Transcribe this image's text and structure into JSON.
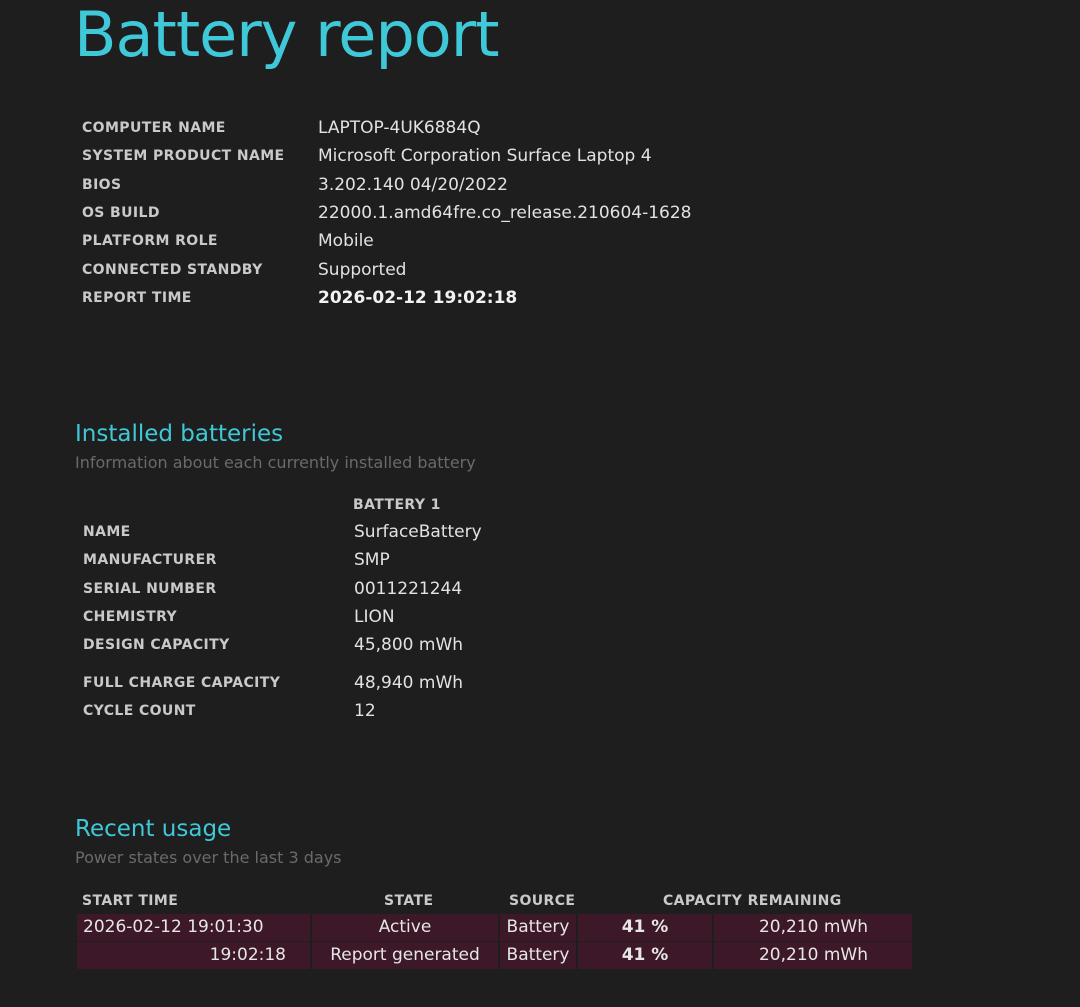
{
  "report": {
    "title": "Battery report"
  },
  "system": {
    "rows": [
      {
        "label": "COMPUTER NAME",
        "value": "LAPTOP-4UK6884Q"
      },
      {
        "label": "SYSTEM PRODUCT NAME",
        "value": "Microsoft Corporation Surface Laptop 4"
      },
      {
        "label": "BIOS",
        "value": "3.202.140 04/20/2022"
      },
      {
        "label": "OS BUILD",
        "value": "22000.1.amd64fre.co_release.210604-1628"
      },
      {
        "label": "PLATFORM ROLE",
        "value": "Mobile"
      },
      {
        "label": "CONNECTED STANDBY",
        "value": "Supported"
      },
      {
        "label": "REPORT TIME",
        "value": "2026-02-12  19:02:18"
      }
    ]
  },
  "installed_batteries": {
    "title": "Installed batteries",
    "subtitle": "Information about each currently installed battery",
    "column_header": "BATTERY 1",
    "rows": [
      {
        "label": "NAME",
        "value": "SurfaceBattery"
      },
      {
        "label": "MANUFACTURER",
        "value": "SMP"
      },
      {
        "label": "SERIAL NUMBER",
        "value": "0011221244"
      },
      {
        "label": "CHEMISTRY",
        "value": "LION"
      },
      {
        "label": "DESIGN CAPACITY",
        "value": "45,800 mWh"
      },
      {
        "label": "FULL CHARGE CAPACITY",
        "value": "48,940 mWh"
      },
      {
        "label": "CYCLE COUNT",
        "value": "12"
      }
    ]
  },
  "recent_usage": {
    "title": "Recent usage",
    "subtitle": "Power states over the last 3 days",
    "headers": {
      "start_time": "START TIME",
      "state": "STATE",
      "source": "SOURCE",
      "capacity": "CAPACITY REMAINING"
    },
    "rows": [
      {
        "start_time": "2026-02-12  19:01:30",
        "state": "Active",
        "source": "Battery",
        "percent": "41 %",
        "mwh": "20,210 mWh"
      },
      {
        "start_time": "19:02:18",
        "state": "Report generated",
        "source": "Battery",
        "percent": "41 %",
        "mwh": "20,210 mWh"
      }
    ]
  },
  "colors": {
    "accent": "#3fc8d8",
    "background": "#1e1e1e",
    "row_background": "#3d1828"
  }
}
